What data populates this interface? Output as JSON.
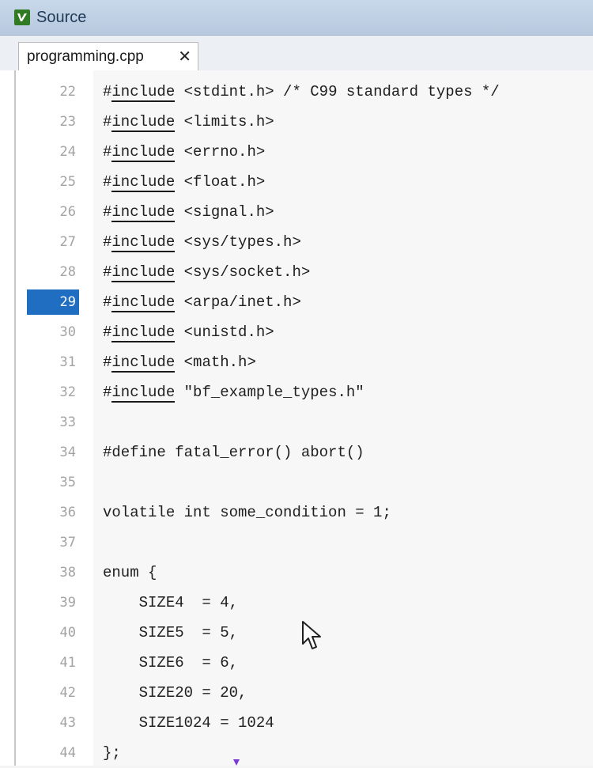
{
  "window": {
    "title": "Source"
  },
  "tab": {
    "label": "programming.cpp",
    "close": "✕"
  },
  "editor": {
    "current_line": 29,
    "lines": [
      {
        "num": "22",
        "kw": "include",
        "rest": " <stdint.h> /* C99 standard types */"
      },
      {
        "num": "23",
        "kw": "include",
        "rest": " <limits.h>"
      },
      {
        "num": "24",
        "kw": "include",
        "rest": " <errno.h>"
      },
      {
        "num": "25",
        "kw": "include",
        "rest": " <float.h>"
      },
      {
        "num": "26",
        "kw": "include",
        "rest": " <signal.h>"
      },
      {
        "num": "27",
        "kw": "include",
        "rest": " <sys/types.h>"
      },
      {
        "num": "28",
        "kw": "include",
        "rest": " <sys/socket.h>"
      },
      {
        "num": "29",
        "kw": "include",
        "rest": " <arpa/inet.h>"
      },
      {
        "num": "30",
        "kw": "include",
        "rest": " <unistd.h>"
      },
      {
        "num": "31",
        "kw": "include",
        "rest": " <math.h>"
      },
      {
        "num": "32",
        "kw": "include",
        "rest": " \"bf_example_types.h\""
      },
      {
        "num": "33",
        "code": ""
      },
      {
        "num": "34",
        "code": "#define fatal_error() abort()"
      },
      {
        "num": "35",
        "code": ""
      },
      {
        "num": "36",
        "code": "volatile int some_condition = 1;"
      },
      {
        "num": "37",
        "code": ""
      },
      {
        "num": "38",
        "code": "enum {"
      },
      {
        "num": "39",
        "code": "    SIZE4  = 4,"
      },
      {
        "num": "40",
        "code": "    SIZE5  = 5,"
      },
      {
        "num": "41",
        "code": "    SIZE6  = 6,"
      },
      {
        "num": "42",
        "code": "    SIZE20 = 20,"
      },
      {
        "num": "43",
        "code": "    SIZE1024 = 1024"
      },
      {
        "num": "44",
        "code": "};"
      }
    ]
  }
}
